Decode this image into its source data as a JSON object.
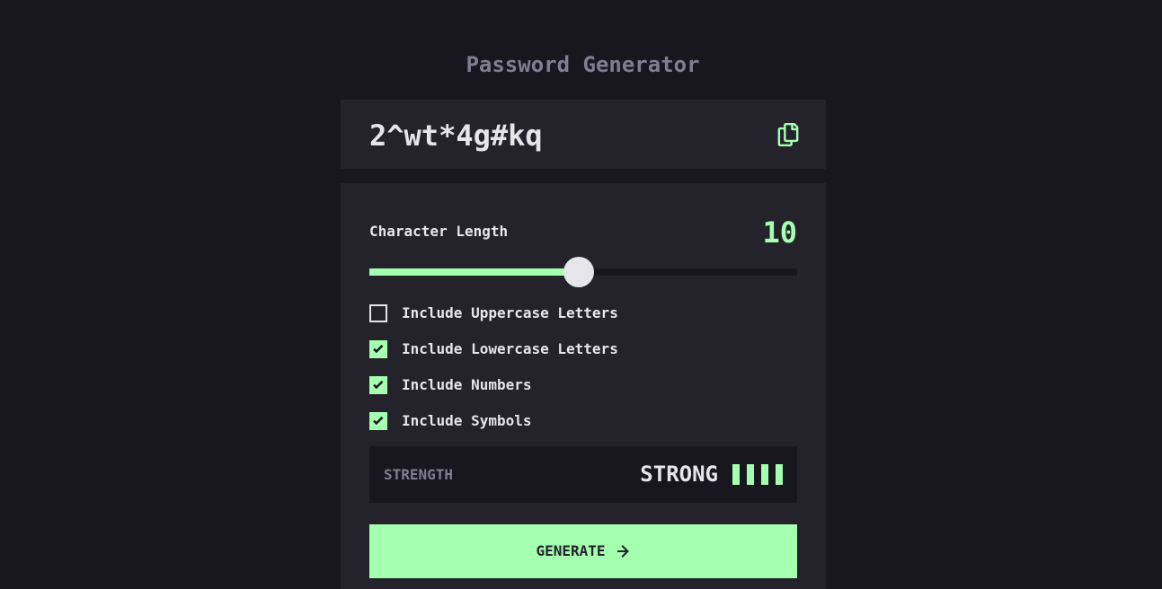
{
  "title": "Password Generator",
  "password": "2^wt*4g#kq",
  "icons": {
    "copy": "copy-icon",
    "check": "check-icon",
    "arrow": "arrow-right-icon"
  },
  "length": {
    "label": "Character Length",
    "value": "10",
    "fill_fraction": 0.49
  },
  "options": [
    {
      "label": "Include Uppercase Letters",
      "checked": false
    },
    {
      "label": "Include Lowercase Letters",
      "checked": true
    },
    {
      "label": "Include Numbers",
      "checked": true
    },
    {
      "label": "Include Symbols",
      "checked": true
    }
  ],
  "strength": {
    "label": "STRENGTH",
    "value": "STRONG",
    "level": 4,
    "max_level": 4
  },
  "generate": {
    "label": "GENERATE"
  },
  "colors": {
    "background": "#18171f",
    "panel": "#24232c",
    "accent": "#a4ffaf",
    "text": "#e6e5ea",
    "muted": "#817d92"
  }
}
